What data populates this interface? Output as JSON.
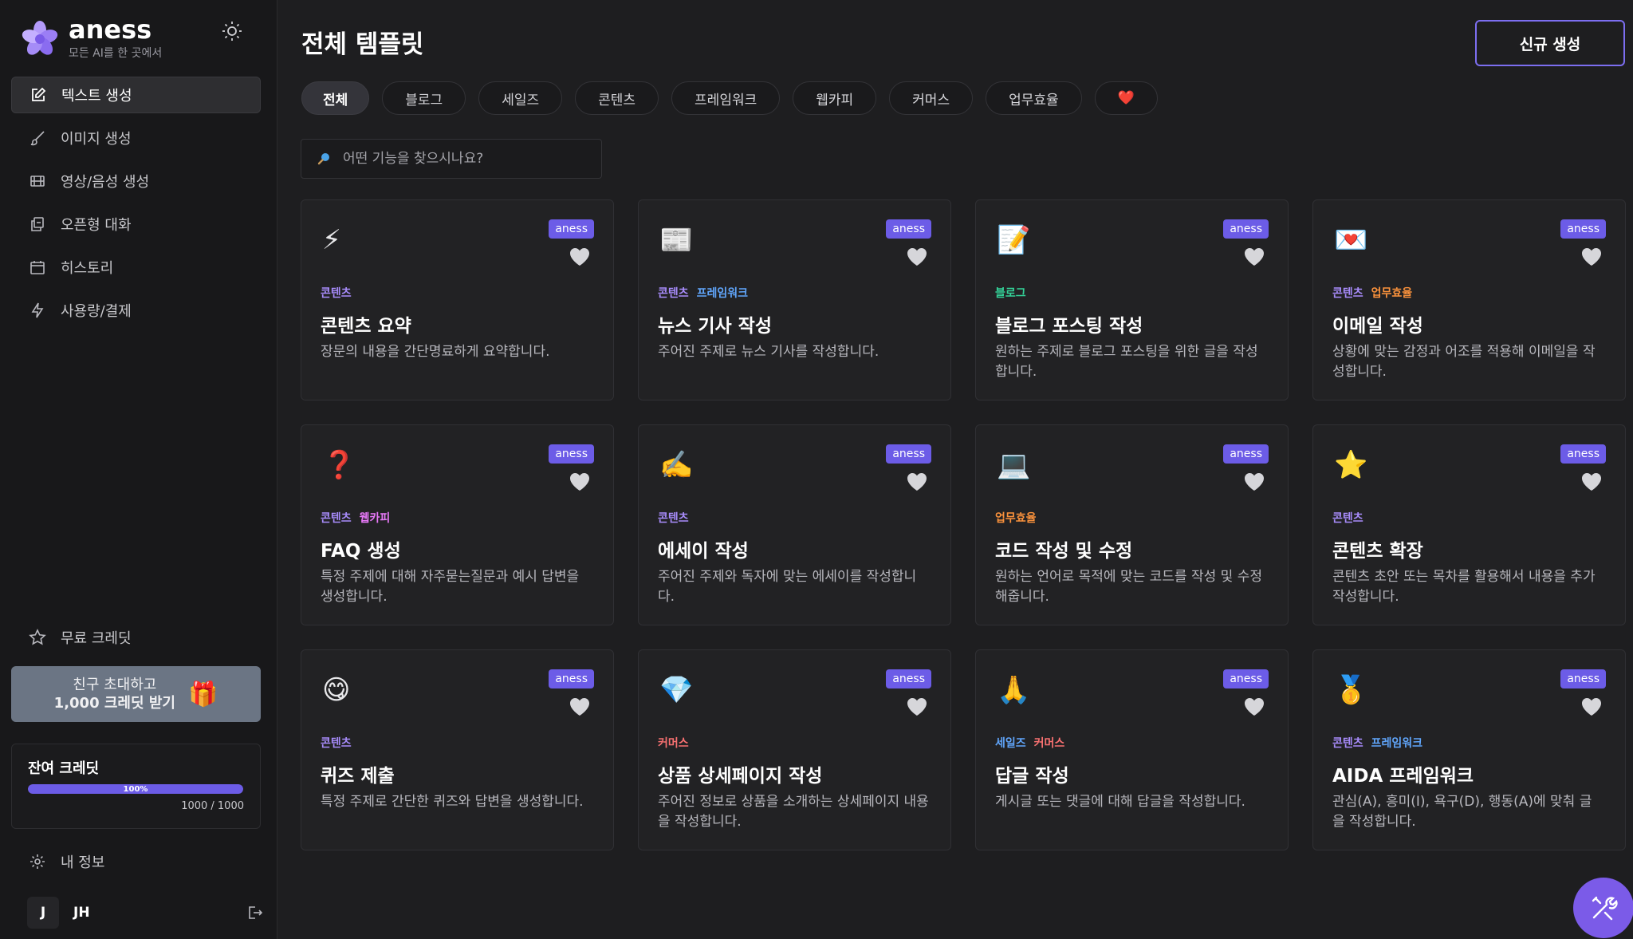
{
  "brand": {
    "name": "aness",
    "tagline": "모든 AI를 한 곳에서"
  },
  "sidebar": {
    "items": [
      {
        "label": "텍스트 생성",
        "icon": "pencil-square-icon",
        "active": true
      },
      {
        "label": "이미지 생성",
        "icon": "brush-icon",
        "active": false
      },
      {
        "label": "영상/음성 생성",
        "icon": "film-icon",
        "active": false
      },
      {
        "label": "오픈형 대화",
        "icon": "chat-copy-icon",
        "active": false
      },
      {
        "label": "히스토리",
        "icon": "calendar-icon",
        "active": false
      },
      {
        "label": "사용량/결제",
        "icon": "lightning-icon",
        "active": false
      }
    ],
    "free_credit": "무료 크레딧",
    "invite": {
      "line1": "친구 초대하고",
      "line2": "1,000 크레딧 받기"
    },
    "credits": {
      "title": "잔여 크레딧",
      "percent_label": "100%",
      "percent": 100,
      "count": "1000 / 1000"
    },
    "profile": "내 정보",
    "user": {
      "initial": "J",
      "name": "JH"
    }
  },
  "header": {
    "title": "전체 템플릿",
    "new_button": "신규 생성"
  },
  "filters": [
    "전체",
    "블로그",
    "세일즈",
    "콘텐츠",
    "프레임워크",
    "웹카피",
    "커머스",
    "업무효율",
    "❤️"
  ],
  "search": {
    "placeholder": "어떤 기능을 찾으시나요?"
  },
  "colors": {
    "accent": "#6c5ce7",
    "tag_content": "#a78bfa",
    "tag_framework": "#60a5fa",
    "tag_blog": "#34d399",
    "tag_efficiency": "#fb923c",
    "tag_webcopy": "#e879f9",
    "tag_commerce": "#f87171",
    "tag_sales": "#60a5fa"
  },
  "cards": [
    {
      "emoji": "⚡",
      "badge": "aness",
      "tags": [
        {
          "label": "콘텐츠",
          "color": "#a78bfa"
        }
      ],
      "title": "콘텐츠 요약",
      "desc": "장문의 내용을 간단명료하게 요약합니다."
    },
    {
      "emoji": "📰",
      "badge": "aness",
      "tags": [
        {
          "label": "콘텐츠",
          "color": "#a78bfa"
        },
        {
          "label": "프레임워크",
          "color": "#60a5fa"
        }
      ],
      "title": "뉴스 기사 작성",
      "desc": "주어진 주제로 뉴스 기사를 작성합니다."
    },
    {
      "emoji": "📝",
      "badge": "aness",
      "tags": [
        {
          "label": "블로그",
          "color": "#34d399"
        }
      ],
      "title": "블로그 포스팅 작성",
      "desc": "원하는 주제로 블로그 포스팅을 위한 글을 작성합니다."
    },
    {
      "emoji": "💌",
      "badge": "aness",
      "tags": [
        {
          "label": "콘텐츠",
          "color": "#a78bfa"
        },
        {
          "label": "업무효율",
          "color": "#fb923c"
        }
      ],
      "title": "이메일 작성",
      "desc": "상황에 맞는 감정과 어조를 적용해 이메일을 작성합니다."
    },
    {
      "emoji": "❓",
      "badge": "aness",
      "tags": [
        {
          "label": "콘텐츠",
          "color": "#a78bfa"
        },
        {
          "label": "웹카피",
          "color": "#e879f9"
        }
      ],
      "title": "FAQ 생성",
      "desc": "특정 주제에 대해 자주묻는질문과 예시 답변을 생성합니다."
    },
    {
      "emoji": "✍️",
      "badge": "aness",
      "tags": [
        {
          "label": "콘텐츠",
          "color": "#a78bfa"
        }
      ],
      "title": "에세이 작성",
      "desc": "주어진 주제와 독자에 맞는 에세이를 작성합니다."
    },
    {
      "emoji": "💻",
      "badge": "aness",
      "tags": [
        {
          "label": "업무효율",
          "color": "#fb923c"
        }
      ],
      "title": "코드 작성 및 수정",
      "desc": "원하는 언어로 목적에 맞는 코드를 작성 및 수정해줍니다."
    },
    {
      "emoji": "⭐",
      "badge": "aness",
      "tags": [
        {
          "label": "콘텐츠",
          "color": "#a78bfa"
        }
      ],
      "title": "콘텐츠 확장",
      "desc": "콘텐츠 초안 또는 목차를 활용해서 내용을 추가 작성합니다."
    },
    {
      "emoji": "😋",
      "badge": "aness",
      "tags": [
        {
          "label": "콘텐츠",
          "color": "#a78bfa"
        }
      ],
      "title": "퀴즈 제출",
      "desc": "특정 주제로 간단한 퀴즈와 답변을 생성합니다."
    },
    {
      "emoji": "💎",
      "badge": "aness",
      "tags": [
        {
          "label": "커머스",
          "color": "#f87171"
        }
      ],
      "title": "상품 상세페이지 작성",
      "desc": "주어진 정보로 상품을 소개하는 상세페이지 내용을 작성합니다."
    },
    {
      "emoji": "🙏",
      "badge": "aness",
      "tags": [
        {
          "label": "세일즈",
          "color": "#60a5fa"
        },
        {
          "label": "커머스",
          "color": "#f87171"
        }
      ],
      "title": "답글 작성",
      "desc": "게시글 또는 댓글에 대해 답글을 작성합니다."
    },
    {
      "emoji": "🥇",
      "badge": "aness",
      "tags": [
        {
          "label": "콘텐츠",
          "color": "#a78bfa"
        },
        {
          "label": "프레임워크",
          "color": "#60a5fa"
        }
      ],
      "title": "AIDA 프레임워크",
      "desc": "관심(A), 흥미(I), 욕구(D), 행동(A)에 맞춰 글을 작성합니다."
    }
  ]
}
